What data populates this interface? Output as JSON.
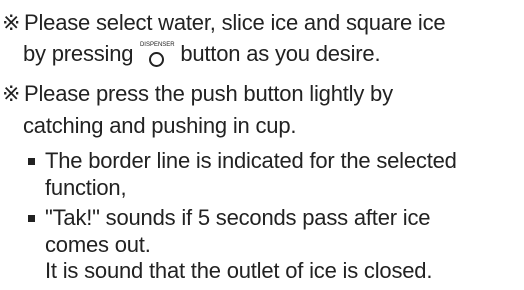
{
  "notes": {
    "mark": "※",
    "note1_line1": "Please select water, slice ice and square ice",
    "note1_before_icon": "by pressing",
    "dispenser_button_caption": "DISPENSER",
    "note1_after_icon": "button as you desire.",
    "note2_line1": "Please press the push button lightly by",
    "note2_line2": "catching and pushing in cup."
  },
  "bullets": {
    "item1_line1": "The border line is indicated for the selected",
    "item1_line2": "function,",
    "item2_line1": "\"Tak!\" sounds if 5 seconds pass after ice",
    "item2_line2": "comes out.",
    "item2_line3": "It is sound that the outlet of ice is closed."
  }
}
